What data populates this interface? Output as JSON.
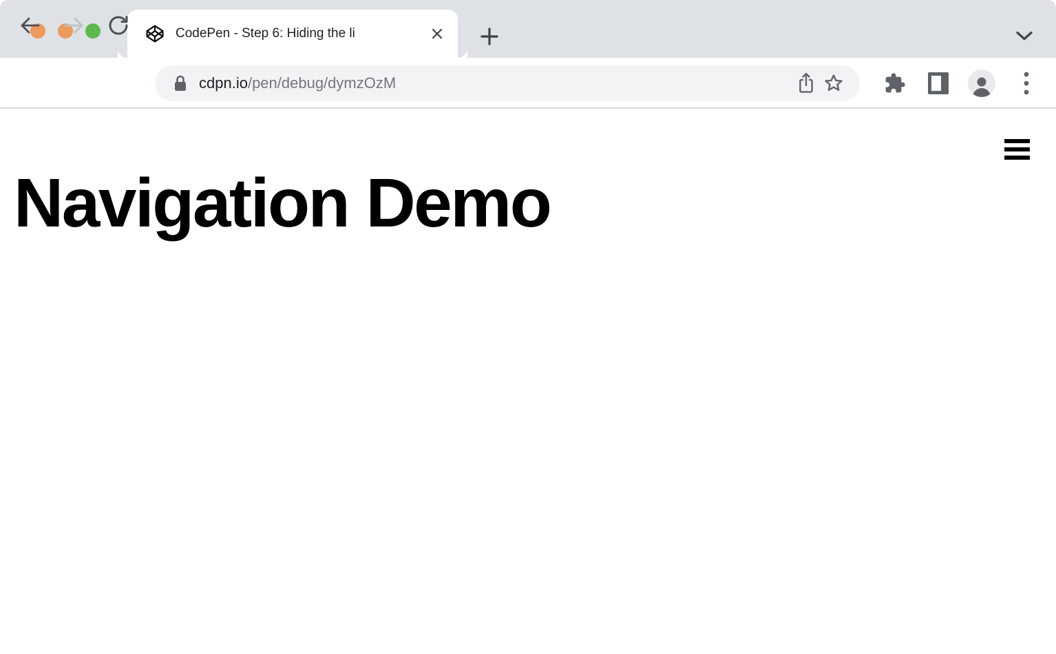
{
  "window": {
    "controls": [
      {
        "name": "close",
        "color": "#EC995C"
      },
      {
        "name": "minimize",
        "color": "#EC995C"
      },
      {
        "name": "zoom",
        "color": "#5BBA4D"
      }
    ]
  },
  "tabstrip": {
    "tab": {
      "title": "CodePen - Step 6: Hiding the li",
      "favicon": "codepen-icon"
    },
    "icons": {
      "close_tab": "close-icon",
      "new_tab": "plus-icon",
      "tab_search": "chevron-down-icon"
    }
  },
  "toolbar": {
    "url": {
      "host": "cdpn.io",
      "path": "/pen/debug/dymzOzM"
    },
    "icons": {
      "back": "arrow-left-icon",
      "forward": "arrow-right-icon",
      "reload": "reload-icon",
      "security": "lock-icon",
      "share": "share-icon",
      "bookmark": "star-icon",
      "extensions": "puzzle-icon",
      "side_panel": "side-panel-icon",
      "profile": "person-icon",
      "menu": "kebab-menu-icon"
    },
    "state": {
      "forward_enabled": false
    }
  },
  "content": {
    "heading": "Navigation Demo",
    "icons": {
      "nav_menu": "hamburger-icon"
    }
  },
  "colors": {
    "tabstrip_bg": "#DEE1E6",
    "toolbar_bg": "#FFFFFF",
    "omnibox_bg": "#F1F3F4",
    "toolbar_border": "#DADCE0",
    "icon_gray": "#5F6368",
    "icon_disabled": "#BFC3C7",
    "text_dark": "#202124",
    "url_path_gray": "#73777C",
    "heading_color": "#000000"
  }
}
